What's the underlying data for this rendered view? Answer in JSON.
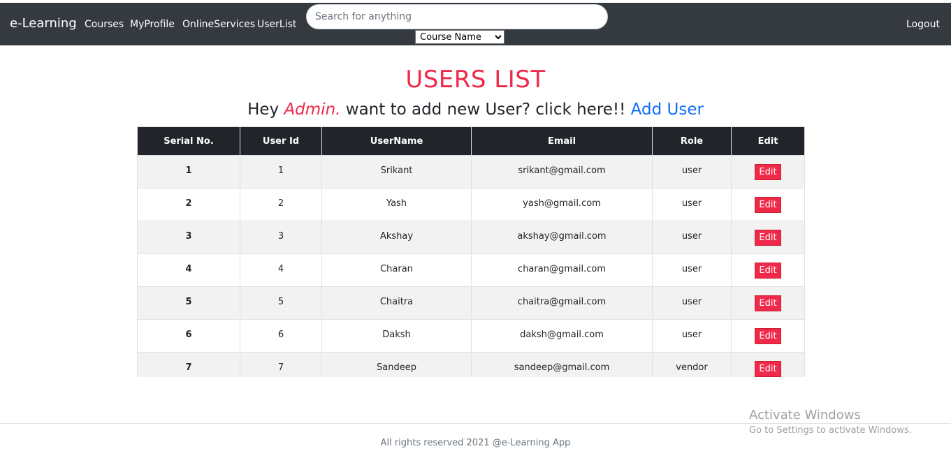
{
  "navbar": {
    "brand": "e-Learning",
    "links": [
      "Courses",
      "MyProfile",
      "OnlineServices",
      "UserList"
    ],
    "search_placeholder": "Search for anything",
    "select_value": "Course Name",
    "logout": "Logout",
    "bg_color": "#343a40"
  },
  "main": {
    "title": "USERS LIST",
    "subtitle_pre": "Hey ",
    "subtitle_admin": "Admin.",
    "subtitle_mid": " want to add new User? click here!! ",
    "add_user_link": "Add User",
    "accent_color": "#f02849",
    "link_color": "#0d6efd"
  },
  "table": {
    "headers": [
      "Serial No.",
      "User Id",
      "UserName",
      "Email",
      "Role",
      "Edit"
    ],
    "edit_label": "Edit",
    "rows": [
      {
        "serial": "1",
        "id": "1",
        "name": "Srikant",
        "email": "srikant@gmail.com",
        "role": "user"
      },
      {
        "serial": "2",
        "id": "2",
        "name": "Yash",
        "email": "yash@gmail.com",
        "role": "user"
      },
      {
        "serial": "3",
        "id": "3",
        "name": "Akshay",
        "email": "akshay@gmail.com",
        "role": "user"
      },
      {
        "serial": "4",
        "id": "4",
        "name": "Charan",
        "email": "charan@gmail.com",
        "role": "user"
      },
      {
        "serial": "5",
        "id": "5",
        "name": "Chaitra",
        "email": "chaitra@gmail.com",
        "role": "user"
      },
      {
        "serial": "6",
        "id": "6",
        "name": "Daksh",
        "email": "daksh@gmail.com",
        "role": "user"
      },
      {
        "serial": "7",
        "id": "7",
        "name": "Sandeep",
        "email": "sandeep@gmail.com",
        "role": "vendor"
      }
    ]
  },
  "footer": {
    "text": "All rights reserved 2021 @e-Learning App"
  },
  "watermark": {
    "title": "Activate Windows",
    "subtitle": "Go to Settings to activate Windows."
  }
}
